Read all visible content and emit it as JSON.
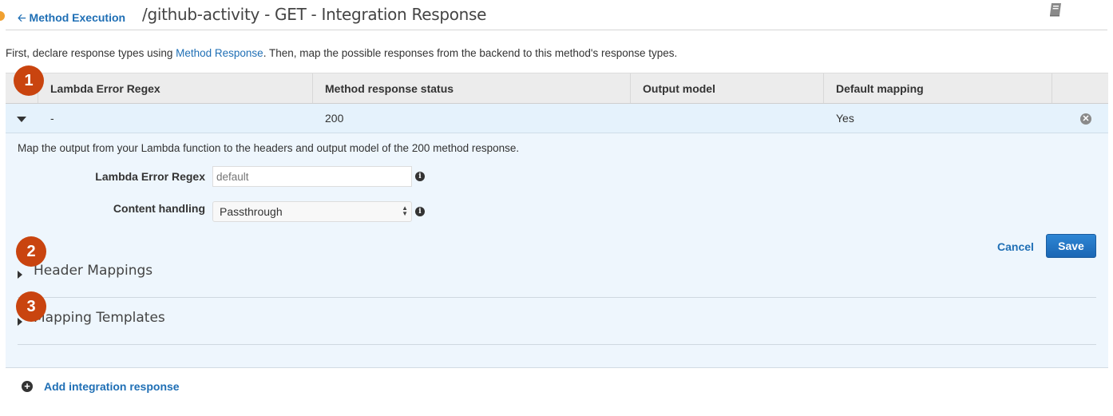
{
  "header": {
    "back_label": "Method Execution",
    "back_icon": "arrow-left-icon",
    "title": "/github-activity - GET - Integration Response",
    "doc_icon": "book-icon"
  },
  "intro": {
    "prefix": "First, declare response types using ",
    "link": "Method Response",
    "suffix": ". Then, map the possible responses from the backend to this method's response types."
  },
  "table": {
    "columns": [
      "",
      "Lambda Error Regex",
      "Method response status",
      "Output model",
      "Default mapping",
      ""
    ],
    "rows": [
      {
        "regex": "-",
        "status": "200",
        "output_model": "",
        "default_mapping": "Yes"
      }
    ]
  },
  "detail": {
    "description": "Map the output from your Lambda function to the headers and output model of the 200 method response.",
    "lambda_error_regex": {
      "label": "Lambda Error Regex",
      "value": "",
      "placeholder": "default"
    },
    "content_handling": {
      "label": "Content handling",
      "selected": "Passthrough"
    },
    "cancel_label": "Cancel",
    "save_label": "Save",
    "sections": [
      {
        "title": "Header Mappings"
      },
      {
        "title": "Mapping Templates"
      }
    ]
  },
  "badges": [
    "1",
    "2",
    "3"
  ],
  "add_integration_response": "Add integration response",
  "colors": {
    "link": "#1f6fb5",
    "badge": "#c9440f",
    "row_selected": "#e5f2fc",
    "panel": "#eef6fd",
    "save_button": "#1f6fb5"
  }
}
